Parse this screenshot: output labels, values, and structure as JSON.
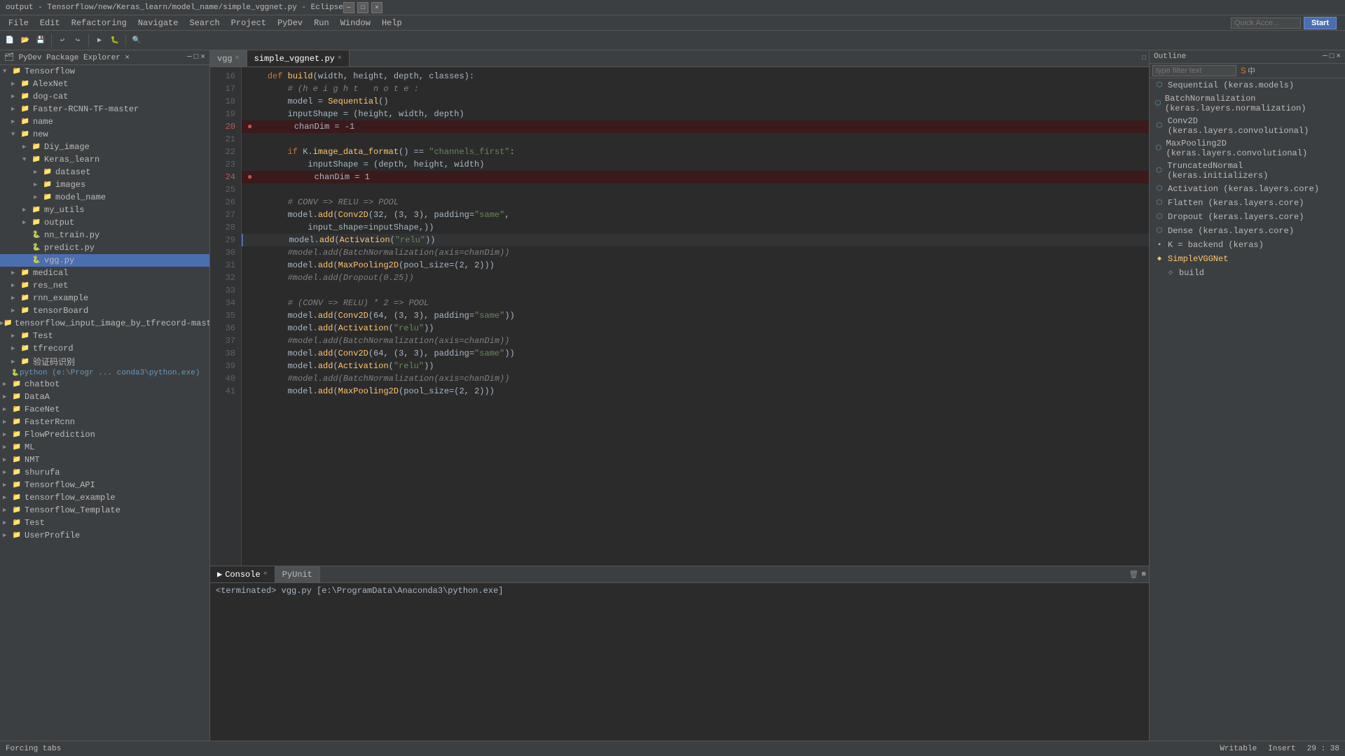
{
  "titlebar": {
    "title": "output - Tensorflow/new/Keras_learn/model_name/simple_vggnet.py - Eclipse",
    "controls": [
      "_",
      "□",
      "×"
    ]
  },
  "menubar": {
    "items": [
      "File",
      "Edit",
      "Refactoring",
      "Navigate",
      "Search",
      "Project",
      "PyDev",
      "Run",
      "Window",
      "Help"
    ]
  },
  "toolbar": {
    "quick_access_placeholder": "Quick Acce...",
    "start_label": "Start"
  },
  "package_explorer": {
    "header": "PyDev Package Explorer",
    "tree": [
      {
        "indent": 0,
        "type": "root_folder",
        "label": "Tensorflow",
        "expanded": true
      },
      {
        "indent": 1,
        "type": "folder",
        "label": "AlexNet",
        "expanded": false
      },
      {
        "indent": 1,
        "type": "folder",
        "label": "dog-cat",
        "expanded": false
      },
      {
        "indent": 1,
        "type": "folder",
        "label": "Faster-RCNN-TF-master",
        "expanded": false
      },
      {
        "indent": 1,
        "type": "folder",
        "label": "name",
        "expanded": false
      },
      {
        "indent": 1,
        "type": "folder",
        "label": "new",
        "expanded": true
      },
      {
        "indent": 2,
        "type": "folder",
        "label": "Diy_image",
        "expanded": false
      },
      {
        "indent": 2,
        "type": "folder",
        "label": "Keras_learn",
        "expanded": true
      },
      {
        "indent": 3,
        "type": "folder",
        "label": "dataset",
        "expanded": false
      },
      {
        "indent": 3,
        "type": "folder",
        "label": "images",
        "expanded": false
      },
      {
        "indent": 3,
        "type": "folder",
        "label": "model_name",
        "expanded": false
      },
      {
        "indent": 2,
        "type": "folder",
        "label": "my_utils",
        "expanded": false
      },
      {
        "indent": 2,
        "type": "folder",
        "label": "output",
        "expanded": false
      },
      {
        "indent": 2,
        "type": "file_py",
        "label": "nn_train.py",
        "expanded": false
      },
      {
        "indent": 2,
        "type": "file_py",
        "label": "predict.py",
        "expanded": false
      },
      {
        "indent": 2,
        "type": "file_vgg",
        "label": "vgg.py",
        "expanded": false
      },
      {
        "indent": 1,
        "type": "folder",
        "label": "medical",
        "expanded": false
      },
      {
        "indent": 1,
        "type": "folder",
        "label": "res_net",
        "expanded": false
      },
      {
        "indent": 1,
        "type": "folder",
        "label": "rnn_example",
        "expanded": false
      },
      {
        "indent": 1,
        "type": "folder",
        "label": "tensorBoard",
        "expanded": false
      },
      {
        "indent": 1,
        "type": "folder",
        "label": "tensorflow_input_image_by_tfrecord-master",
        "expanded": false
      },
      {
        "indent": 1,
        "type": "folder",
        "label": "Test",
        "expanded": false
      },
      {
        "indent": 1,
        "type": "folder",
        "label": "tfrecord",
        "expanded": false
      },
      {
        "indent": 1,
        "type": "folder",
        "label": "验证码识别",
        "expanded": false
      },
      {
        "indent": 1,
        "type": "interpreter",
        "label": "python  (e:\\Progr ... conda3\\python.exe)",
        "expanded": false
      },
      {
        "indent": 0,
        "type": "folder",
        "label": "chatbot",
        "expanded": false
      },
      {
        "indent": 0,
        "type": "folder",
        "label": "DataA",
        "expanded": false
      },
      {
        "indent": 0,
        "type": "folder",
        "label": "FaceNet",
        "expanded": false
      },
      {
        "indent": 0,
        "type": "folder",
        "label": "FasterRcnn",
        "expanded": false
      },
      {
        "indent": 0,
        "type": "folder",
        "label": "FlowPrediction",
        "expanded": false
      },
      {
        "indent": 0,
        "type": "folder",
        "label": "ML",
        "expanded": false
      },
      {
        "indent": 0,
        "type": "folder",
        "label": "NMT",
        "expanded": false
      },
      {
        "indent": 0,
        "type": "folder",
        "label": "shurufa",
        "expanded": false
      },
      {
        "indent": 0,
        "type": "folder",
        "label": "Tensorflow_API",
        "expanded": false
      },
      {
        "indent": 0,
        "type": "folder",
        "label": "tensorflow_example",
        "expanded": false
      },
      {
        "indent": 0,
        "type": "folder",
        "label": "Tensorflow_Template",
        "expanded": false
      },
      {
        "indent": 0,
        "type": "folder",
        "label": "Test",
        "expanded": false
      },
      {
        "indent": 0,
        "type": "folder",
        "label": "UserProfile",
        "expanded": false
      }
    ]
  },
  "editor": {
    "tabs": [
      {
        "label": "vgg",
        "active": false,
        "closeable": true
      },
      {
        "label": "simple_vggnet.py",
        "active": true,
        "closeable": true
      }
    ],
    "lines": [
      {
        "num": 16,
        "content": "    def build(width, height, depth, classes):",
        "has_bp": false,
        "active": false
      },
      {
        "num": 17,
        "content": "        # (h e i g h t   n o t e :",
        "has_bp": false,
        "active": false,
        "comment": true
      },
      {
        "num": 18,
        "content": "        model = Sequential()",
        "has_bp": false,
        "active": false
      },
      {
        "num": 19,
        "content": "        inputShape = (height, width, depth)",
        "has_bp": false,
        "active": false
      },
      {
        "num": 20,
        "content": "        chanDim = -1",
        "has_bp": true,
        "active": false
      },
      {
        "num": 21,
        "content": "",
        "has_bp": false,
        "active": false
      },
      {
        "num": 22,
        "content": "        if K.image_data_format() == \"channels_first\":",
        "has_bp": false,
        "active": false
      },
      {
        "num": 23,
        "content": "            inputShape = (depth, height, width)",
        "has_bp": false,
        "active": false
      },
      {
        "num": 24,
        "content": "            chanDim = 1",
        "has_bp": true,
        "active": false
      },
      {
        "num": 25,
        "content": "",
        "has_bp": false,
        "active": false
      },
      {
        "num": 26,
        "content": "        # CONV => RELU => POOL",
        "has_bp": false,
        "active": false,
        "comment": true
      },
      {
        "num": 27,
        "content": "        model.add(Conv2D(32, (3, 3), padding=\"same\",",
        "has_bp": false,
        "active": false
      },
      {
        "num": 28,
        "content": "            input_shape=inputShape,))",
        "has_bp": false,
        "active": false
      },
      {
        "num": 29,
        "content": "        model.add(Activation(\"relu\"))",
        "has_bp": false,
        "active": true
      },
      {
        "num": 30,
        "content": "        #model.add(BatchNormalization(axis=chanDim))",
        "has_bp": false,
        "active": false,
        "comment": true
      },
      {
        "num": 31,
        "content": "        model.add(MaxPooling2D(pool_size=(2, 2)))",
        "has_bp": false,
        "active": false
      },
      {
        "num": 32,
        "content": "        #model.add(Dropout(0.25))",
        "has_bp": false,
        "active": false,
        "comment": true
      },
      {
        "num": 33,
        "content": "",
        "has_bp": false,
        "active": false
      },
      {
        "num": 34,
        "content": "        # (CONV => RELU) * 2 => POOL",
        "has_bp": false,
        "active": false,
        "comment": true
      },
      {
        "num": 35,
        "content": "        model.add(Conv2D(64, (3, 3), padding=\"same\"))",
        "has_bp": false,
        "active": false
      },
      {
        "num": 36,
        "content": "        model.add(Activation(\"relu\"))",
        "has_bp": false,
        "active": false
      },
      {
        "num": 37,
        "content": "        #model.add(BatchNormalization(axis=chanDim))",
        "has_bp": false,
        "active": false,
        "comment": true
      },
      {
        "num": 38,
        "content": "        model.add(Conv2D(64, (3, 3), padding=\"same\"))",
        "has_bp": false,
        "active": false
      },
      {
        "num": 39,
        "content": "        model.add(Activation(\"relu\"))",
        "has_bp": false,
        "active": false
      },
      {
        "num": 40,
        "content": "        #model.add(BatchNormalization(axis=chanDim))",
        "has_bp": false,
        "active": false,
        "comment": true
      },
      {
        "num": 41,
        "content": "        model.add(MaxPooling2D(pool_size=(2, 2)))",
        "has_bp": false,
        "active": false
      }
    ]
  },
  "outline": {
    "header": "Outline",
    "filter_placeholder": "type filter text",
    "items": [
      {
        "label": "Sequential (keras.models)",
        "icon": "class",
        "indent": 0
      },
      {
        "label": "BatchNormalization (keras.layers.normalization)",
        "icon": "class",
        "indent": 0
      },
      {
        "label": "Conv2D (keras.layers.convolutional)",
        "icon": "class",
        "indent": 0
      },
      {
        "label": "MaxPooling2D (keras.layers.convolutional)",
        "icon": "class",
        "indent": 0
      },
      {
        "label": "TruncatedNormal (keras.initializers)",
        "icon": "class",
        "indent": 0
      },
      {
        "label": "Activation (keras.layers.core)",
        "icon": "class",
        "indent": 0
      },
      {
        "label": "Flatten (keras.layers.core)",
        "icon": "class",
        "indent": 0
      },
      {
        "label": "Dropout (keras.layers.core)",
        "icon": "class",
        "indent": 0
      },
      {
        "label": "Dense (keras.layers.core)",
        "icon": "class",
        "indent": 0
      },
      {
        "label": "K = backend (keras)",
        "icon": "var",
        "indent": 0
      },
      {
        "label": "SimpleVGGNet",
        "icon": "class_main",
        "indent": 0
      },
      {
        "label": "build",
        "icon": "method",
        "indent": 1
      }
    ]
  },
  "bottom": {
    "tabs": [
      {
        "label": "Console",
        "active": true,
        "icon": "console"
      },
      {
        "label": "PyUnit",
        "active": false,
        "icon": "pyunit"
      }
    ],
    "console_text": "<terminated> vgg.py [e:\\ProgramData\\Anaconda3\\python.exe]"
  },
  "statusbar": {
    "forcing_tabs": "Forcing tabs",
    "writable": "Writable",
    "insert": "Insert",
    "position": "29 : 38"
  }
}
